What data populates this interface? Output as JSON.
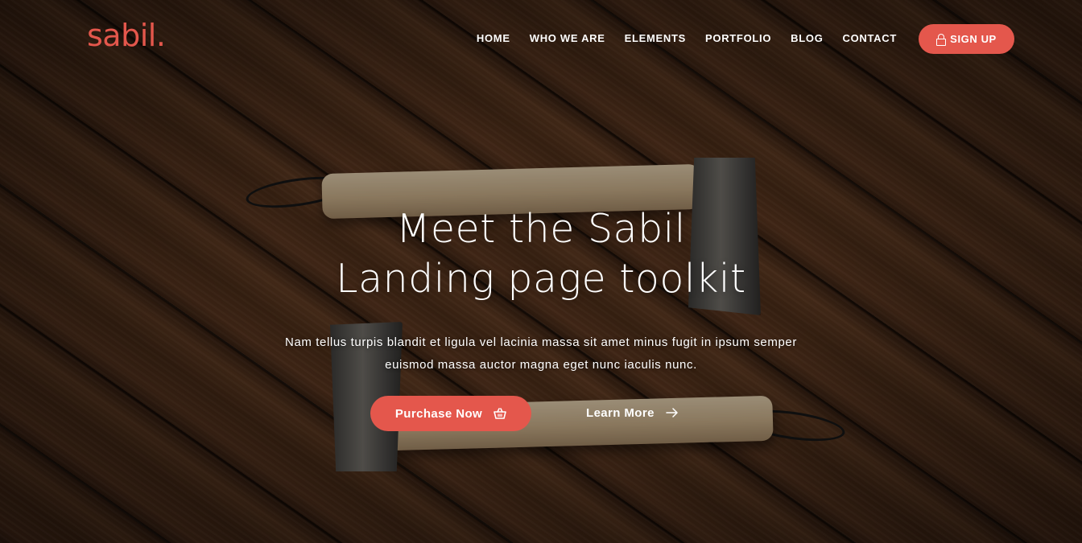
{
  "brand": {
    "logo": "sabil.",
    "accent_color": "#e4574c"
  },
  "nav": {
    "items": [
      {
        "label": "HOME"
      },
      {
        "label": "WHO WE ARE"
      },
      {
        "label": "ELEMENTS"
      },
      {
        "label": "PORTFOLIO"
      },
      {
        "label": "BLOG"
      },
      {
        "label": "CONTACT"
      }
    ],
    "signup": {
      "label": "SIGN UP",
      "icon": "lock-icon"
    }
  },
  "hero": {
    "title_line1": "Meet the Sabil",
    "title_line2": "Landing page toolkit",
    "subtitle_line1": "Nam tellus turpis blandit et ligula vel lacinia massa sit amet minus fugit in ipsum semper",
    "subtitle_line2": "euismod massa auctor magna eget nunc iaculis nunc.",
    "primary_button": {
      "label": "Purchase Now",
      "icon": "basket-icon"
    },
    "secondary_button": {
      "label": "Learn More",
      "icon": "arrow-right-icon"
    },
    "background": "wooden-floor-with-axes-image"
  }
}
